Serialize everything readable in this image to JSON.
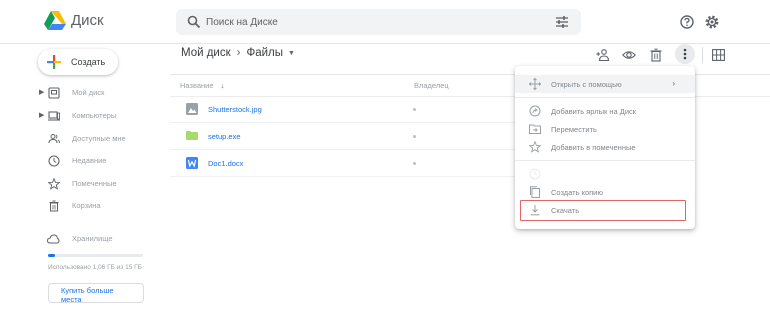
{
  "app": {
    "name": "Диск"
  },
  "search": {
    "placeholder": "Поиск на Диске"
  },
  "sidebar": {
    "create_label": "Создать",
    "items": [
      {
        "label": "Мой диск",
        "icon": "my-drive-icon",
        "expandable": true
      },
      {
        "label": "Компьютеры",
        "icon": "computer-icon",
        "expandable": true
      },
      {
        "label": "Доступные мне",
        "icon": "shared-icon",
        "expandable": false
      },
      {
        "label": "Недавние",
        "icon": "clock-icon",
        "expandable": false
      },
      {
        "label": "Помеченные",
        "icon": "star-icon",
        "expandable": false
      },
      {
        "label": "Корзина",
        "icon": "trash-icon",
        "expandable": false
      }
    ],
    "storage": {
      "label": "Хранилище",
      "usage_text": "Использовано 1,06 ГБ из 15 ГБ",
      "fraction": 0.07,
      "buy_more": "Купить больше места"
    }
  },
  "breadcrumb": {
    "root": "Мой диск",
    "separator": "›",
    "current": "Файлы"
  },
  "table": {
    "headers": {
      "name": "Название",
      "owner": "Владелец"
    },
    "files": [
      {
        "name": "Shutterstock.jpg",
        "type": "image",
        "icon": "image-file-icon",
        "color": "#9aa0a6"
      },
      {
        "name": "setup.exe",
        "type": "exe",
        "icon": "exe-file-icon",
        "color": "#a8d86e"
      },
      {
        "name": "Doc1.docx",
        "type": "docx",
        "icon": "word-file-icon",
        "color": "#4285f4"
      }
    ]
  },
  "context_menu": {
    "items": [
      {
        "label": "Открыть с помощью",
        "icon": "move-arrows-icon",
        "submenu": true,
        "state": "hover"
      },
      {
        "label": "Добавить ярлык на Диск",
        "icon": "shortcut-icon"
      },
      {
        "label": "Переместить",
        "icon": "move-folder-icon"
      },
      {
        "label": "Добавить в помеченные",
        "icon": "star-outline-icon"
      },
      {
        "label": "Создать копию",
        "icon": "copy-icon"
      },
      {
        "label": "Скачать",
        "icon": "download-icon",
        "highlighted": true
      }
    ]
  },
  "colors": {
    "accent": "#1a73e8",
    "highlight_border": "#e06666"
  }
}
